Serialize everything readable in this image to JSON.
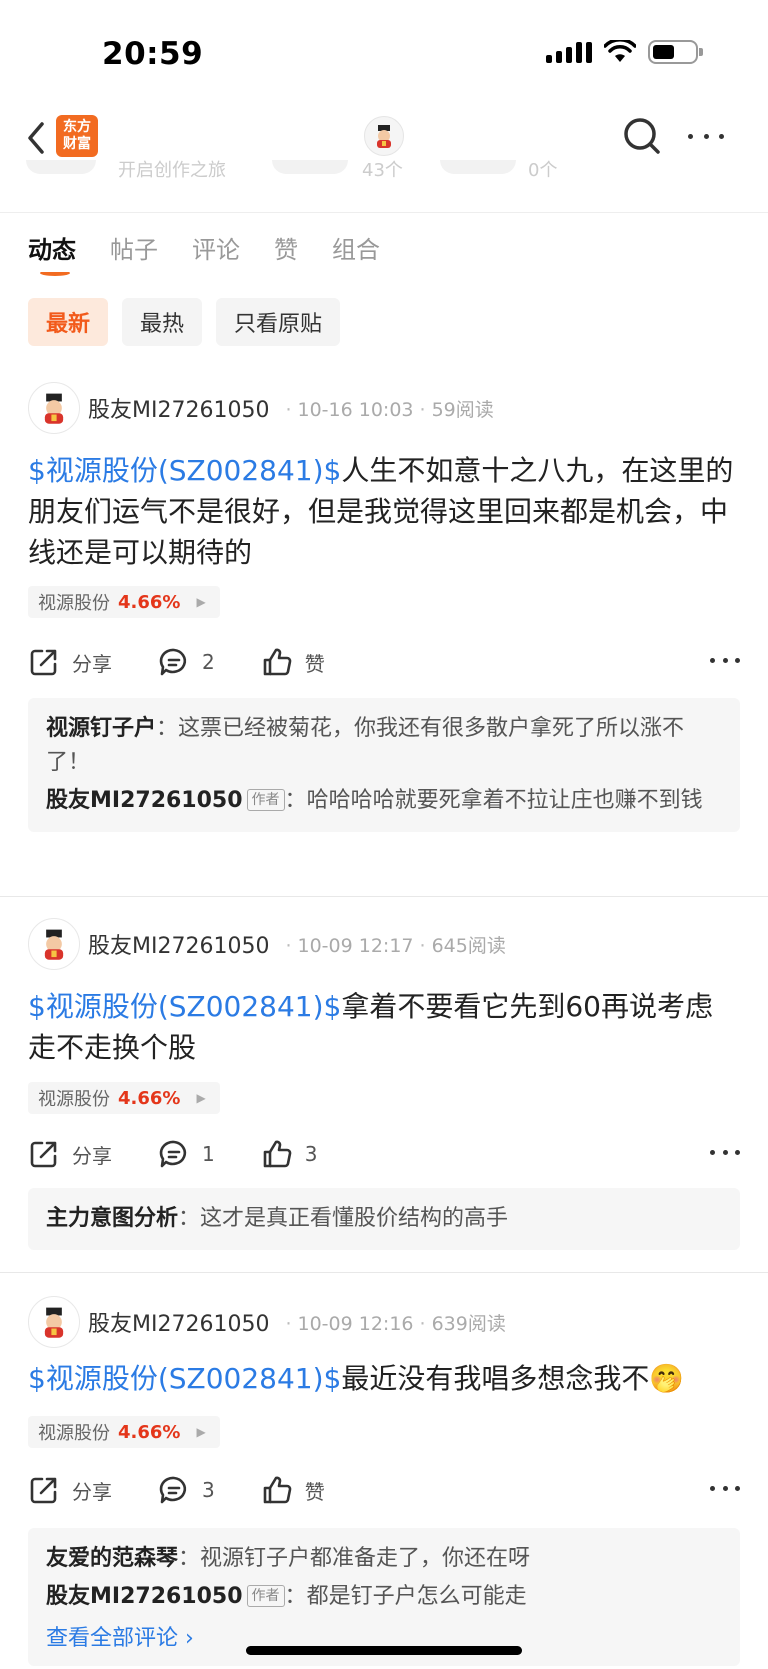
{
  "status_bar": {
    "time": "20:59"
  },
  "nav": {
    "logo_text": "东方\n财富"
  },
  "faded_row": {
    "text1": "开启创作之旅",
    "text2": "43个",
    "text3": "0个"
  },
  "tabs": [
    {
      "label": "动态",
      "active": true
    },
    {
      "label": "帖子",
      "active": false
    },
    {
      "label": "评论",
      "active": false
    },
    {
      "label": "赞",
      "active": false
    },
    {
      "label": "组合",
      "active": false
    }
  ],
  "filters": [
    {
      "label": "最新",
      "active": true
    },
    {
      "label": "最热",
      "active": false
    },
    {
      "label": "只看原贴",
      "active": false
    }
  ],
  "posts": [
    {
      "author": "股友MI27261050",
      "date": "10-16 10:03",
      "reads": "59阅读",
      "stock_link": "$视源股份(SZ002841)$",
      "text": "人生不如意十之八九，在这里的朋友们运气不是很好，但是我觉得这里回来都是机会，中线还是可以期待的",
      "tag_name": "视源股份",
      "tag_pct": "4.66%",
      "share_label": "分享",
      "comment_count": "2",
      "like_label": "赞",
      "comments": [
        {
          "name": "视源钉子户",
          "is_author": false,
          "sep": "：",
          "text": "这票已经被菊花，你我还有很多散户拿死了所以涨不了！"
        },
        {
          "name": "股友MI27261050",
          "is_author": true,
          "badge": "作者",
          "sep": "：",
          "text": "哈哈哈哈就要死拿着不拉让庄也赚不到钱"
        }
      ]
    },
    {
      "author": "股友MI27261050",
      "date": "10-09 12:17",
      "reads": "645阅读",
      "stock_link": "$视源股份(SZ002841)$",
      "text": "拿着不要看它先到60再说考虑走不走换个股",
      "tag_name": "视源股份",
      "tag_pct": "4.66%",
      "share_label": "分享",
      "comment_count": "1",
      "like_label": "3",
      "comments": [
        {
          "name": "主力意图分析",
          "is_author": false,
          "sep": "：",
          "text": "这才是真正看懂股价结构的高手"
        }
      ]
    },
    {
      "author": "股友MI27261050",
      "date": "10-09 12:16",
      "reads": "639阅读",
      "stock_link": "$视源股份(SZ002841)$",
      "text": "最近没有我唱多想念我不🤭",
      "tag_name": "视源股份",
      "tag_pct": "4.66%",
      "share_label": "分享",
      "comment_count": "3",
      "like_label": "赞",
      "comments": [
        {
          "name": "友爱的范森琴",
          "is_author": false,
          "sep": "：",
          "text": "视源钉子户都准备走了，你还在呀"
        },
        {
          "name": "股友MI27261050",
          "is_author": true,
          "badge": "作者",
          "sep": "：",
          "text": "都是钉子户怎么可能走"
        }
      ],
      "see_all": "查看全部评论 ›"
    }
  ],
  "colors": {
    "accent": "#f26b21",
    "link": "#2b7be4",
    "up": "#e4361a"
  }
}
